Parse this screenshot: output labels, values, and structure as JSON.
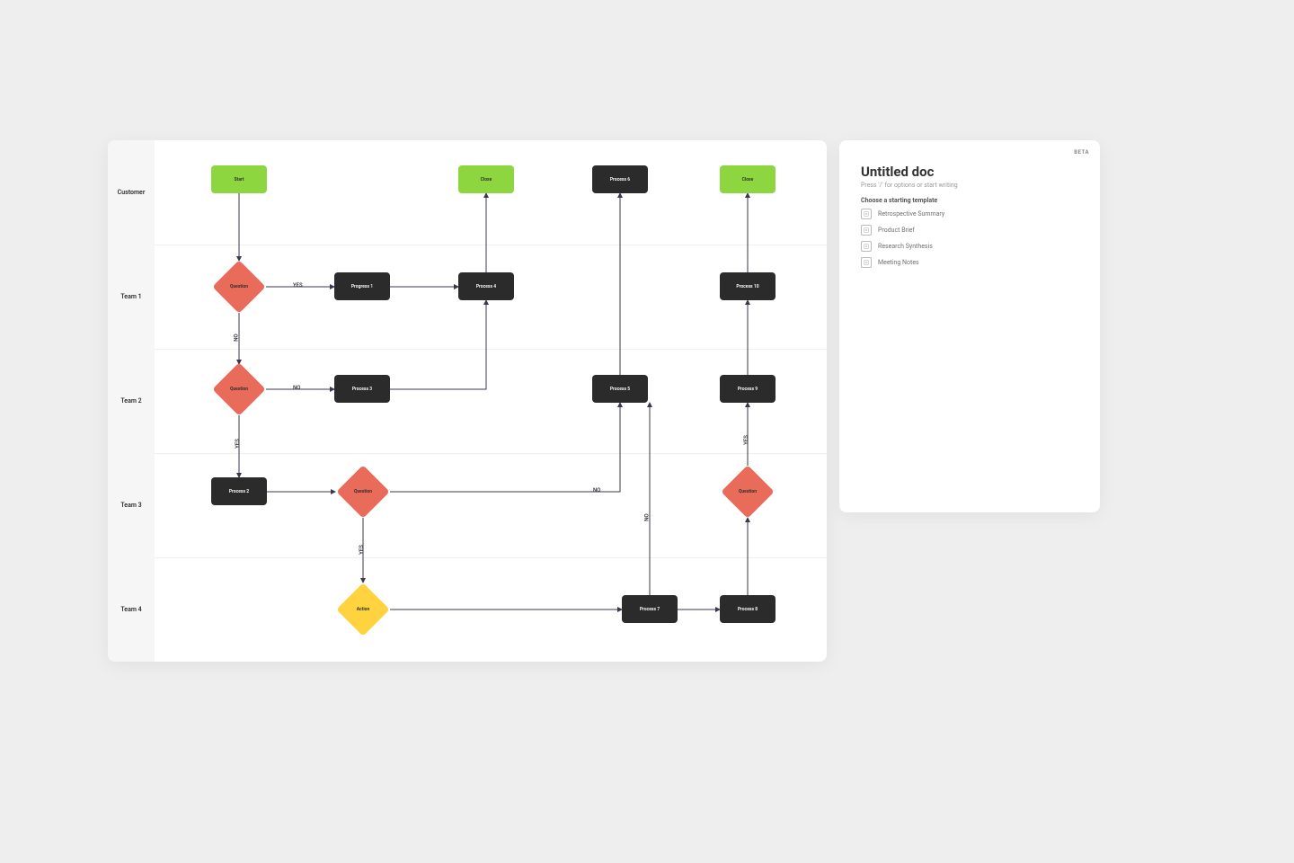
{
  "lanes": [
    {
      "id": "customer",
      "label": "Customer"
    },
    {
      "id": "team1",
      "label": "Team 1"
    },
    {
      "id": "team2",
      "label": "Team 2"
    },
    {
      "id": "team3",
      "label": "Team 3"
    },
    {
      "id": "team4",
      "label": "Team 4"
    }
  ],
  "nodes": {
    "start": {
      "label": "Start",
      "lane": "customer",
      "type": "terminator",
      "color": "green"
    },
    "close1": {
      "label": "Close",
      "lane": "customer",
      "type": "terminator",
      "color": "green"
    },
    "process6": {
      "label": "Process 6",
      "lane": "customer",
      "type": "process",
      "color": "dark"
    },
    "close2": {
      "label": "Close",
      "lane": "customer",
      "type": "terminator",
      "color": "green"
    },
    "q1": {
      "label": "Question",
      "lane": "team1",
      "type": "decision",
      "color": "red"
    },
    "progress1": {
      "label": "Progress 1",
      "lane": "team1",
      "type": "process",
      "color": "dark"
    },
    "process4": {
      "label": "Process 4",
      "lane": "team1",
      "type": "process",
      "color": "dark"
    },
    "process10": {
      "label": "Process 10",
      "lane": "team1",
      "type": "process",
      "color": "dark"
    },
    "q2": {
      "label": "Question",
      "lane": "team2",
      "type": "decision",
      "color": "red"
    },
    "process3": {
      "label": "Process 3",
      "lane": "team2",
      "type": "process",
      "color": "dark"
    },
    "process5": {
      "label": "Process 5",
      "lane": "team2",
      "type": "process",
      "color": "dark"
    },
    "process9": {
      "label": "Process 9",
      "lane": "team2",
      "type": "process",
      "color": "dark"
    },
    "process2": {
      "label": "Process 2",
      "lane": "team3",
      "type": "process",
      "color": "dark"
    },
    "q3": {
      "label": "Question",
      "lane": "team3",
      "type": "decision",
      "color": "red"
    },
    "q4": {
      "label": "Question",
      "lane": "team3",
      "type": "decision",
      "color": "red"
    },
    "action": {
      "label": "Action",
      "lane": "team4",
      "type": "decision",
      "color": "yellow"
    },
    "process7": {
      "label": "Process 7",
      "lane": "team4",
      "type": "process",
      "color": "dark"
    },
    "process8": {
      "label": "Process 8",
      "lane": "team4",
      "type": "process",
      "color": "dark"
    }
  },
  "edges": [
    {
      "from": "start",
      "to": "q1",
      "label": ""
    },
    {
      "from": "q1",
      "to": "progress1",
      "label": "YES"
    },
    {
      "from": "q1",
      "to": "q2",
      "label": "NO"
    },
    {
      "from": "progress1",
      "to": "process4",
      "label": ""
    },
    {
      "from": "process4",
      "to": "close1",
      "label": ""
    },
    {
      "from": "q2",
      "to": "process3",
      "label": "NO"
    },
    {
      "from": "q2",
      "to": "process2",
      "label": "YES"
    },
    {
      "from": "process3",
      "to": "process4",
      "label": ""
    },
    {
      "from": "process2",
      "to": "q3",
      "label": ""
    },
    {
      "from": "q3",
      "to": "action",
      "label": "YES"
    },
    {
      "from": "q3",
      "to": "process5",
      "label": "NO"
    },
    {
      "from": "process5",
      "to": "process6",
      "label": ""
    },
    {
      "from": "action",
      "to": "process7",
      "label": ""
    },
    {
      "from": "process7",
      "to": "process8",
      "label": ""
    },
    {
      "from": "process7",
      "to": "process5",
      "label": "NO"
    },
    {
      "from": "process8",
      "to": "q4",
      "label": ""
    },
    {
      "from": "q4",
      "to": "process9",
      "label": ""
    },
    {
      "from": "process9",
      "to": "process10",
      "label": "YES"
    },
    {
      "from": "process10",
      "to": "close2",
      "label": ""
    }
  ],
  "doc": {
    "beta": "BETA",
    "title": "Untitled doc",
    "hint": "Press '/' for options or start writing",
    "template_heading": "Choose a starting template",
    "templates": [
      "Retrospective Summary",
      "Product Brief",
      "Research Synthesis",
      "Meeting Notes"
    ]
  }
}
